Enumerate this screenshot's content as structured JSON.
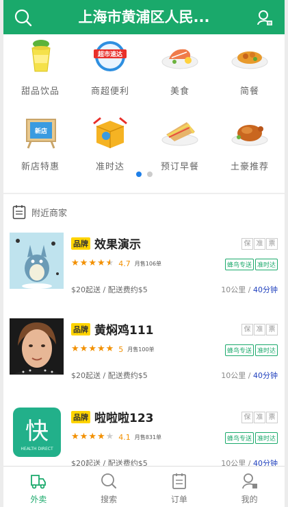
{
  "header": {
    "location": "上海市黄浦区人民..."
  },
  "categories": [
    {
      "label": "甜品饮品",
      "icon": "drink-cup-icon"
    },
    {
      "label": "商超便利",
      "icon": "supermarket-icon"
    },
    {
      "label": "美食",
      "icon": "food-plate-icon"
    },
    {
      "label": "简餐",
      "icon": "simple-meal-icon"
    },
    {
      "label": "新店特惠",
      "icon": "new-store-icon"
    },
    {
      "label": "准时达",
      "icon": "on-time-box-icon"
    },
    {
      "label": "预订早餐",
      "icon": "sandwich-icon"
    },
    {
      "label": "土豪推荐",
      "icon": "roast-chicken-icon"
    }
  ],
  "carousel": {
    "pages": 2,
    "current": 1
  },
  "nearby": {
    "title": "附近商家"
  },
  "shops": [
    {
      "brand": "品牌",
      "name": "效果演示",
      "tags": [
        "保",
        "准",
        "票"
      ],
      "rating": "4.7",
      "stars": 4.7,
      "sold": "月售106单",
      "badges": [
        "蜂鸟专送",
        "准时达"
      ],
      "fee": "$20起送 / 配送费约$5",
      "distance": "10公里 / ",
      "time": "40分钟"
    },
    {
      "brand": "品牌",
      "name": "黄焖鸡111",
      "tags": [
        "保",
        "准",
        "票"
      ],
      "rating": "5",
      "stars": 5,
      "sold": "月售100单",
      "badges": [
        "蜂鸟专送",
        "准时达"
      ],
      "fee": "$20起送 / 配送费约$5",
      "distance": "10公里 / ",
      "time": "40分钟"
    },
    {
      "brand": "品牌",
      "name": "啦啦啦123",
      "tags": [
        "保",
        "准",
        "票"
      ],
      "rating": "4.1",
      "stars": 4.1,
      "sold": "月售831单",
      "badges": [
        "蜂鸟专送",
        "准时达"
      ],
      "fee": "$20起送 / 配送费约$5",
      "distance": "10公里 / ",
      "time": "40分钟",
      "logo_text": "快",
      "logo_sub": "HEALTH DIRECT"
    }
  ],
  "tabbar": [
    {
      "label": "外卖",
      "icon": "delivery-truck-icon",
      "active": true
    },
    {
      "label": "搜索",
      "icon": "search-icon",
      "active": false
    },
    {
      "label": "订单",
      "icon": "order-list-icon",
      "active": false
    },
    {
      "label": "我的",
      "icon": "profile-icon",
      "active": false
    }
  ],
  "colors": {
    "primary": "#1aa96b",
    "star": "#f29000",
    "brand_tag": "#ffd400",
    "dot_active": "#1e7fe8",
    "time": "#1e3fbd"
  }
}
